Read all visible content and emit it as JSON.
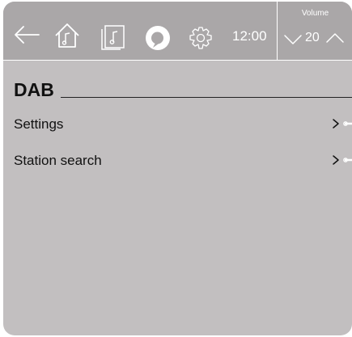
{
  "topbar": {
    "icons": [
      "back-arrow-icon",
      "home-music-icon",
      "music-library-icon",
      "assistant-icon",
      "settings-gear-icon"
    ],
    "time": "12:00",
    "volume": {
      "label": "Volume",
      "value": "20"
    }
  },
  "page": {
    "title": "DAB"
  },
  "menu": {
    "items": [
      {
        "label": "Settings"
      },
      {
        "label": "Station search"
      }
    ]
  },
  "colors": {
    "background": "#c2bfc0",
    "topbar": "#aaa7a8",
    "text": "#111111",
    "icon": "#ffffff"
  }
}
